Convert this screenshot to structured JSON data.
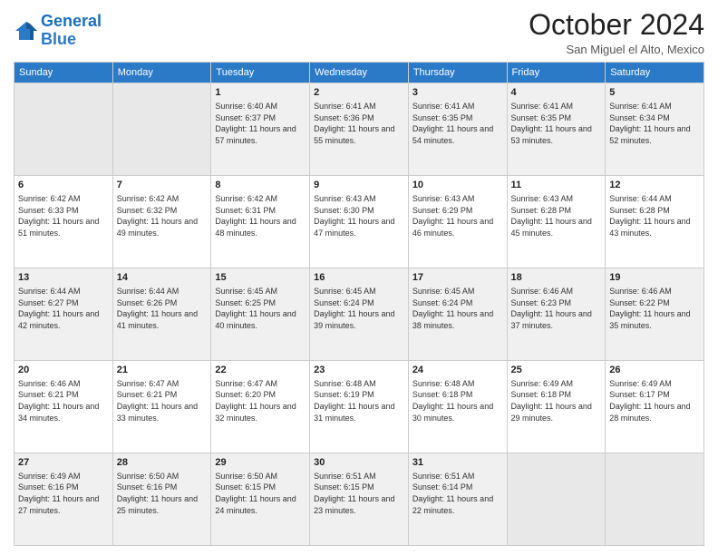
{
  "logo": {
    "line1": "General",
    "line2": "Blue"
  },
  "header": {
    "month": "October 2024",
    "location": "San Miguel el Alto, Mexico"
  },
  "weekdays": [
    "Sunday",
    "Monday",
    "Tuesday",
    "Wednesday",
    "Thursday",
    "Friday",
    "Saturday"
  ],
  "weeks": [
    [
      {
        "day": "",
        "info": ""
      },
      {
        "day": "",
        "info": ""
      },
      {
        "day": "1",
        "info": "Sunrise: 6:40 AM\nSunset: 6:37 PM\nDaylight: 11 hours and 57 minutes."
      },
      {
        "day": "2",
        "info": "Sunrise: 6:41 AM\nSunset: 6:36 PM\nDaylight: 11 hours and 55 minutes."
      },
      {
        "day": "3",
        "info": "Sunrise: 6:41 AM\nSunset: 6:35 PM\nDaylight: 11 hours and 54 minutes."
      },
      {
        "day": "4",
        "info": "Sunrise: 6:41 AM\nSunset: 6:35 PM\nDaylight: 11 hours and 53 minutes."
      },
      {
        "day": "5",
        "info": "Sunrise: 6:41 AM\nSunset: 6:34 PM\nDaylight: 11 hours and 52 minutes."
      }
    ],
    [
      {
        "day": "6",
        "info": "Sunrise: 6:42 AM\nSunset: 6:33 PM\nDaylight: 11 hours and 51 minutes."
      },
      {
        "day": "7",
        "info": "Sunrise: 6:42 AM\nSunset: 6:32 PM\nDaylight: 11 hours and 49 minutes."
      },
      {
        "day": "8",
        "info": "Sunrise: 6:42 AM\nSunset: 6:31 PM\nDaylight: 11 hours and 48 minutes."
      },
      {
        "day": "9",
        "info": "Sunrise: 6:43 AM\nSunset: 6:30 PM\nDaylight: 11 hours and 47 minutes."
      },
      {
        "day": "10",
        "info": "Sunrise: 6:43 AM\nSunset: 6:29 PM\nDaylight: 11 hours and 46 minutes."
      },
      {
        "day": "11",
        "info": "Sunrise: 6:43 AM\nSunset: 6:28 PM\nDaylight: 11 hours and 45 minutes."
      },
      {
        "day": "12",
        "info": "Sunrise: 6:44 AM\nSunset: 6:28 PM\nDaylight: 11 hours and 43 minutes."
      }
    ],
    [
      {
        "day": "13",
        "info": "Sunrise: 6:44 AM\nSunset: 6:27 PM\nDaylight: 11 hours and 42 minutes."
      },
      {
        "day": "14",
        "info": "Sunrise: 6:44 AM\nSunset: 6:26 PM\nDaylight: 11 hours and 41 minutes."
      },
      {
        "day": "15",
        "info": "Sunrise: 6:45 AM\nSunset: 6:25 PM\nDaylight: 11 hours and 40 minutes."
      },
      {
        "day": "16",
        "info": "Sunrise: 6:45 AM\nSunset: 6:24 PM\nDaylight: 11 hours and 39 minutes."
      },
      {
        "day": "17",
        "info": "Sunrise: 6:45 AM\nSunset: 6:24 PM\nDaylight: 11 hours and 38 minutes."
      },
      {
        "day": "18",
        "info": "Sunrise: 6:46 AM\nSunset: 6:23 PM\nDaylight: 11 hours and 37 minutes."
      },
      {
        "day": "19",
        "info": "Sunrise: 6:46 AM\nSunset: 6:22 PM\nDaylight: 11 hours and 35 minutes."
      }
    ],
    [
      {
        "day": "20",
        "info": "Sunrise: 6:46 AM\nSunset: 6:21 PM\nDaylight: 11 hours and 34 minutes."
      },
      {
        "day": "21",
        "info": "Sunrise: 6:47 AM\nSunset: 6:21 PM\nDaylight: 11 hours and 33 minutes."
      },
      {
        "day": "22",
        "info": "Sunrise: 6:47 AM\nSunset: 6:20 PM\nDaylight: 11 hours and 32 minutes."
      },
      {
        "day": "23",
        "info": "Sunrise: 6:48 AM\nSunset: 6:19 PM\nDaylight: 11 hours and 31 minutes."
      },
      {
        "day": "24",
        "info": "Sunrise: 6:48 AM\nSunset: 6:18 PM\nDaylight: 11 hours and 30 minutes."
      },
      {
        "day": "25",
        "info": "Sunrise: 6:49 AM\nSunset: 6:18 PM\nDaylight: 11 hours and 29 minutes."
      },
      {
        "day": "26",
        "info": "Sunrise: 6:49 AM\nSunset: 6:17 PM\nDaylight: 11 hours and 28 minutes."
      }
    ],
    [
      {
        "day": "27",
        "info": "Sunrise: 6:49 AM\nSunset: 6:16 PM\nDaylight: 11 hours and 27 minutes."
      },
      {
        "day": "28",
        "info": "Sunrise: 6:50 AM\nSunset: 6:16 PM\nDaylight: 11 hours and 25 minutes."
      },
      {
        "day": "29",
        "info": "Sunrise: 6:50 AM\nSunset: 6:15 PM\nDaylight: 11 hours and 24 minutes."
      },
      {
        "day": "30",
        "info": "Sunrise: 6:51 AM\nSunset: 6:15 PM\nDaylight: 11 hours and 23 minutes."
      },
      {
        "day": "31",
        "info": "Sunrise: 6:51 AM\nSunset: 6:14 PM\nDaylight: 11 hours and 22 minutes."
      },
      {
        "day": "",
        "info": ""
      },
      {
        "day": "",
        "info": ""
      }
    ]
  ]
}
